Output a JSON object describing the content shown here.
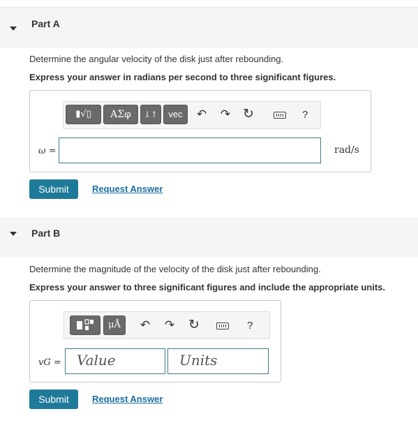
{
  "part_a": {
    "title": "Part A",
    "question": "Determine the angular velocity of the disk just after rebounding.",
    "instruction": "Express your answer in radians per second to three significant figures.",
    "toolbar": {
      "templates_label": "▮√▯",
      "greek_label": "ΑΣφ",
      "arrows_label": "↓↑",
      "vec_label": "vec",
      "undo_icon": "undo-icon",
      "redo_icon": "redo-icon",
      "reset_icon": "reset-icon",
      "keyboard_icon": "keyboard-icon",
      "help_label": "?"
    },
    "variable_label": "ω =",
    "answer_value": "",
    "unit": "rad/s",
    "submit_label": "Submit",
    "request_label": "Request Answer"
  },
  "part_b": {
    "title": "Part B",
    "question": "Determine the magnitude of the velocity of the disk just after rebounding.",
    "instruction": "Express your answer to three significant figures and include the appropriate units.",
    "toolbar": {
      "templates_icon": "templates-icon",
      "units_label": "μÅ",
      "help_label": "?"
    },
    "variable_label": "vG =",
    "value_placeholder": "Value",
    "units_placeholder": "Units",
    "submit_label": "Submit",
    "request_label": "Request Answer"
  }
}
